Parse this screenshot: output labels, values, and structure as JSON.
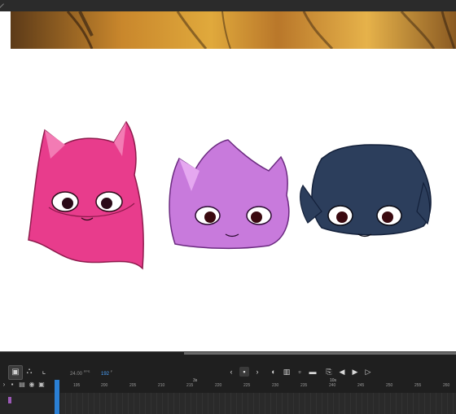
{
  "timeline": {
    "fps": "24.00",
    "fps_unit": "FPS",
    "current_frame": "192",
    "frame_unit": "F",
    "markers": [
      "3s",
      "10s"
    ],
    "ruler_labels": [
      "195",
      "200",
      "205",
      "210",
      "215",
      "220",
      "225",
      "230",
      "235",
      "240",
      "245",
      "250",
      "255",
      "260"
    ]
  },
  "icons": {
    "camera": "camera-icon",
    "layer_parent": "layer-parenting-icon",
    "graph": "graph-icon",
    "prev_keyframe": "chevron-left-icon",
    "insert_keyframe": "keyframe-icon",
    "next_keyframe": "chevron-right-icon",
    "onion_skin": "onion-skin-icon",
    "edit_multiple": "edit-multiple-frames-icon",
    "step_back": "step-back-icon",
    "play": "play-icon",
    "step_forward": "step-forward-icon"
  },
  "colors": {
    "pink_cat": "#e83c8c",
    "purple_cat": "#c87adc",
    "navy_cat": "#2c3e5c",
    "playhead": "#2a7fd4",
    "accent_frame": "#4aa3ff"
  }
}
